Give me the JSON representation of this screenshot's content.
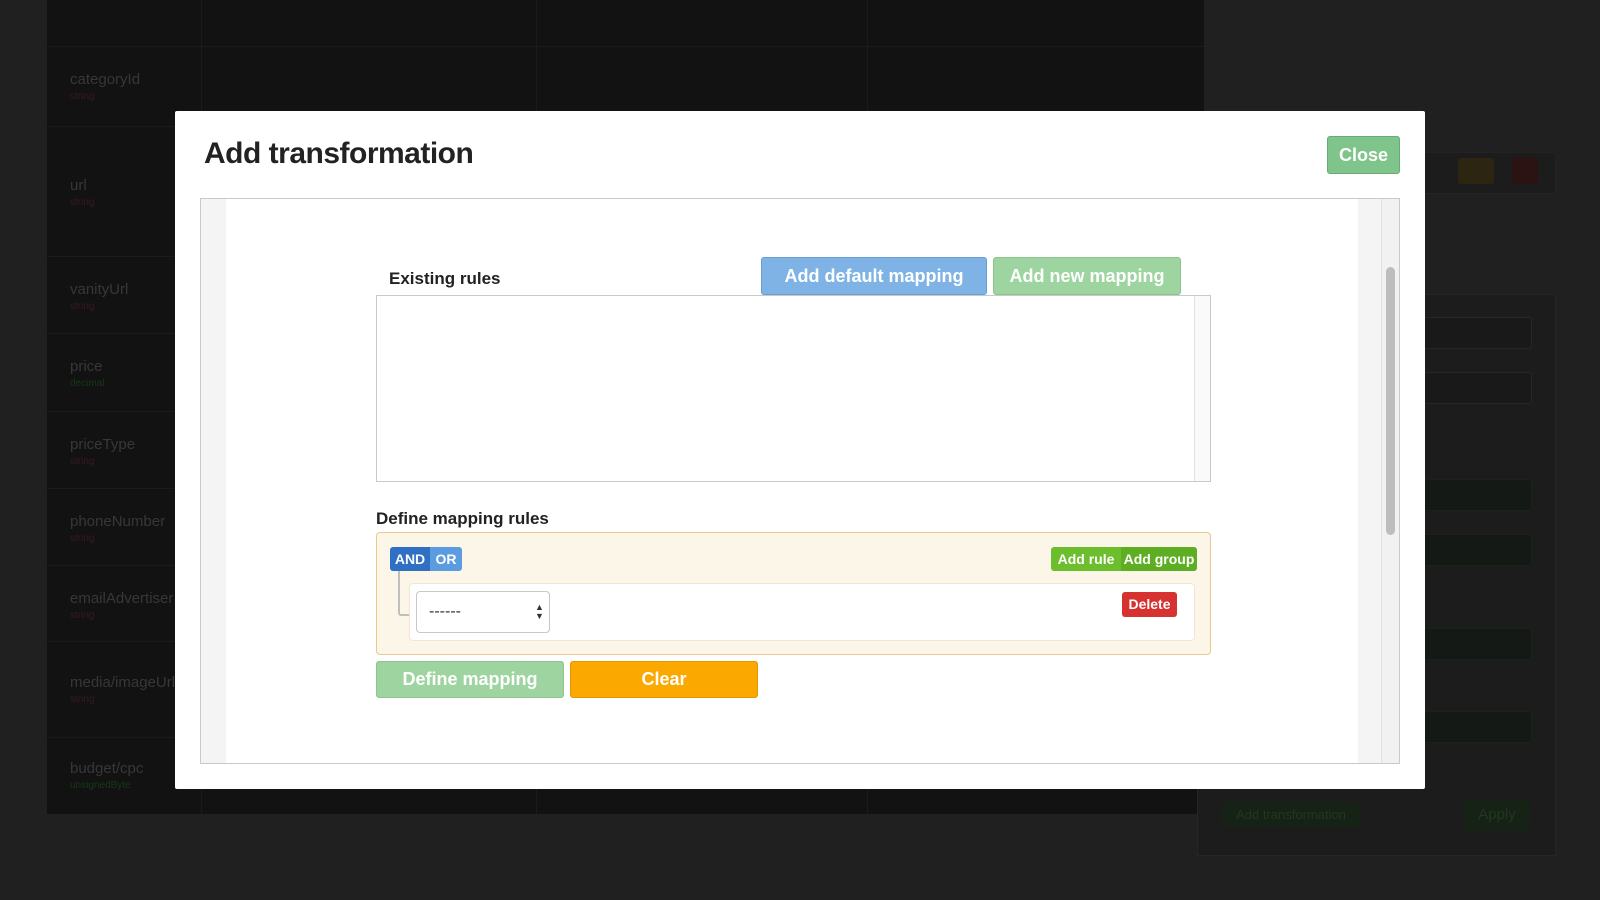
{
  "background": {
    "fields": [
      {
        "name": "categoryId",
        "type": "string"
      },
      {
        "name": "url",
        "type": "string"
      },
      {
        "name": "vanityUrl",
        "type": "string"
      },
      {
        "name": "price",
        "type": "decimal"
      },
      {
        "name": "priceType",
        "type": "string"
      },
      {
        "name": "phoneNumber",
        "type": "string"
      },
      {
        "name": "emailAdvertiser",
        "type": "string"
      },
      {
        "name": "media/imageUrl",
        "type": "string"
      },
      {
        "name": "budget/cpc",
        "type": "unsignedByte"
      }
    ],
    "panel": {
      "add_transformation_label": "Add transformation",
      "apply_label": "Apply"
    }
  },
  "modal": {
    "title": "Add transformation",
    "close_label": "Close",
    "existing_rules_label": "Existing rules",
    "add_default_mapping_label": "Add default mapping",
    "add_new_mapping_label": "Add new mapping",
    "define_rules_label": "Define mapping rules",
    "builder": {
      "and_label": "AND",
      "or_label": "OR",
      "add_rule_label": "Add rule",
      "add_group_label": "Add group",
      "delete_label": "Delete",
      "field_select_value": "------"
    },
    "define_mapping_label": "Define mapping",
    "clear_label": "Clear"
  },
  "colors": {
    "close": "#7fc48a",
    "add_default": "#7fb3e6",
    "add_new": "#9ed49f",
    "and": "#2f70c4",
    "or": "#5b9be0",
    "add_rule": "#6cbe2c",
    "delete": "#d6322f",
    "clear": "#fba800",
    "builder_bg": "#fcf6e8"
  }
}
